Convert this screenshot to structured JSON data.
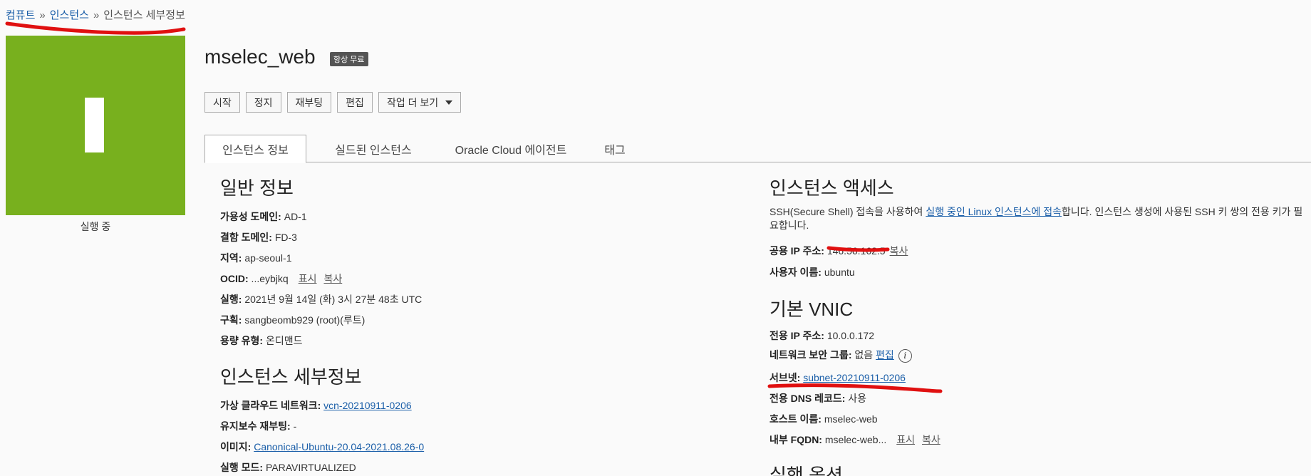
{
  "breadcrumb": {
    "compute": "컴퓨트",
    "instances": "인스턴스",
    "current": "인스턴스 세부정보",
    "sep": "»"
  },
  "status": {
    "label": "실행 중",
    "color": "#78b01e"
  },
  "instance": {
    "name": "mselec_web",
    "badge": "항상 무료"
  },
  "toolbar": {
    "start": "시작",
    "stop": "정지",
    "reboot": "재부팅",
    "edit": "편집",
    "more": "작업 더 보기"
  },
  "tabs": [
    "인스턴스 정보",
    "실드된 인스턴스",
    "Oracle Cloud 에이전트",
    "태그"
  ],
  "general": {
    "title": "일반 정보",
    "ad_label": "가용성 도메인:",
    "ad_value": " AD-1",
    "fd_label": "결함 도메인:",
    "fd_value": " FD-3",
    "region_label": "지역:",
    "region_value": " ap-seoul-1",
    "ocid_label": "OCID:",
    "ocid_value": " ...eybjkq",
    "show": "표시",
    "copy": "복사",
    "launched_label": "실행:",
    "launched_value": " 2021년 9월 14일 (화) 3시 27분 48초 UTC",
    "compartment_label": "구획:",
    "compartment_value": " sangbeomb929 (root)(루트)",
    "capacity_label": "용량 유형:",
    "capacity_value": " 온디맨드"
  },
  "details": {
    "title": "인스턴스 세부정보",
    "vcn_label": "가상 클라우드 네트워크:",
    "vcn_value": "vcn-20210911-0206",
    "maint_label": "유지보수 재부팅:",
    "maint_value": " -",
    "image_label": "이미지:",
    "image_value": "Canonical-Ubuntu-20.04-2021.08.26-0",
    "mode_label": "실행 모드:",
    "mode_value": " PARAVIRTUALIZED"
  },
  "access": {
    "title": "인스턴스 액세스",
    "desc_before": "SSH(Secure Shell) 접속을 사용하여 ",
    "desc_link": "실행 중인 Linux 인스턴스에 접속",
    "desc_after": "합니다. 인스턴스 생성에 사용된 SSH 키 쌍의 전용 키가 필요합니다.",
    "public_ip_label": "공용 IP 주소:",
    "public_ip_value": " 146.56.162.5",
    "copy": "복사",
    "user_label": "사용자 이름:",
    "user_value": " ubuntu"
  },
  "vnic": {
    "title": "기본 VNIC",
    "private_ip_label": "전용 IP 주소:",
    "private_ip_value": " 10.0.0.172",
    "nsg_label": "네트워크 보안 그룹:",
    "nsg_value": " 없음 ",
    "nsg_edit": "편집",
    "subnet_label": "서브넷:",
    "subnet_value": "subnet-20210911-0206",
    "dns_label": "전용 DNS 레코드:",
    "dns_value": " 사용",
    "host_label": "호스트 이름:",
    "host_value": " mselec-web",
    "fqdn_label": "내부 FQDN:",
    "fqdn_value": " mselec-web...",
    "show": "표시",
    "copy": "복사"
  },
  "launch_options": {
    "title": "실행 옵션"
  },
  "colors": {
    "link": "#1a5ea8",
    "annotation": "#e01010",
    "running": "#78b01e"
  }
}
